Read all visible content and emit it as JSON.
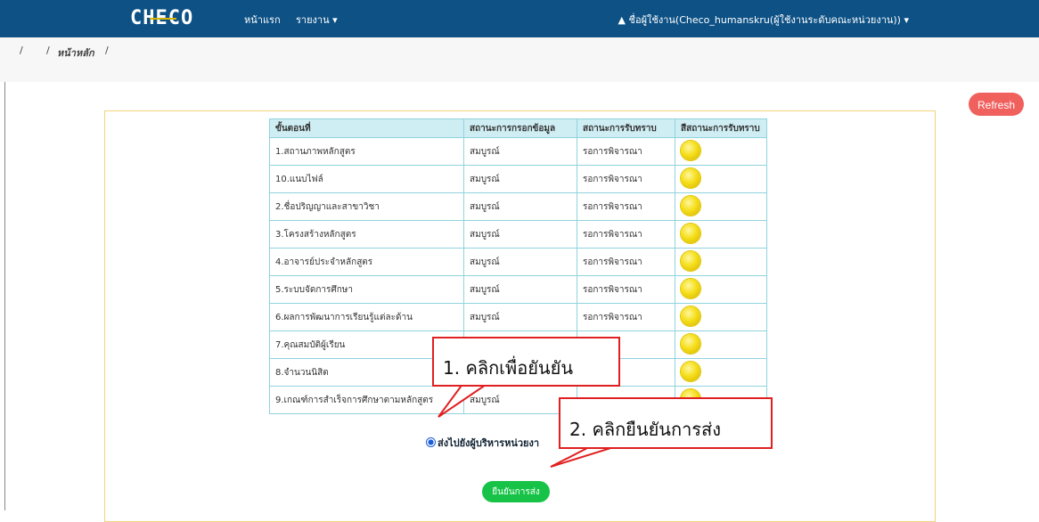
{
  "navbar": {
    "brand": "CHECO",
    "menu_home": "หน้าแรก",
    "menu_report": "รายงาน ▾",
    "user": "▲ ชื่อผู้ใช้งาน(Checo_humanskru(ผู้ใช้งานระดับคณะหน่วยงาน)) ▾"
  },
  "breadcrumb": {
    "sep1": "/",
    "sep2": "/",
    "current": "หน้าหลัก",
    "sep3": "/"
  },
  "refresh_label": "Refresh",
  "table": {
    "headers": [
      "ขั้นตอนที่",
      "สถานะการกรอกข้อมูล",
      "สถานะการรับทราบ",
      "สีสถานะการรับทราบ"
    ],
    "rows": [
      {
        "step": "1.สถานภาพหลักสูตร",
        "fill": "สมบูรณ์",
        "ack": "รอการพิจารณา"
      },
      {
        "step": "10.แนบไฟล์",
        "fill": "สมบูรณ์",
        "ack": "รอการพิจารณา"
      },
      {
        "step": "2.ชื่อปริญญาและสาขาวิชา",
        "fill": "สมบูรณ์",
        "ack": "รอการพิจารณา"
      },
      {
        "step": "3.โครงสร้างหลักสูตร",
        "fill": "สมบูรณ์",
        "ack": "รอการพิจารณา"
      },
      {
        "step": "4.อาจารย์ประจำหลักสูตร",
        "fill": "สมบูรณ์",
        "ack": "รอการพิจารณา"
      },
      {
        "step": "5.ระบบจัดการศึกษา",
        "fill": "สมบูรณ์",
        "ack": "รอการพิจารณา"
      },
      {
        "step": "6.ผลการพัฒนาการเรียนรู้แต่ละด้าน",
        "fill": "สมบูรณ์",
        "ack": "รอการพิจารณา"
      },
      {
        "step": "7.คุณสมบัติผู้เรียน",
        "fill": "",
        "ack": "ารณา"
      },
      {
        "step": "8.จำนวนนิสิต",
        "fill": "",
        "ack": "ารณา"
      },
      {
        "step": "9.เกณฑ์การสำเร็จการศึกษาตามหลักสูตร",
        "fill": "สมบูรณ์",
        "ack": ""
      }
    ],
    "status_color": "#f5df1a"
  },
  "radio_label": "ส่งไปยังผู้บริหารหน่วยงา",
  "confirm_label": "ยืนยันการส่ง",
  "callouts": {
    "c1": "1. คลิกเพื่อยันยัน",
    "c2": "2. คลิกยืนยันการส่ง"
  }
}
